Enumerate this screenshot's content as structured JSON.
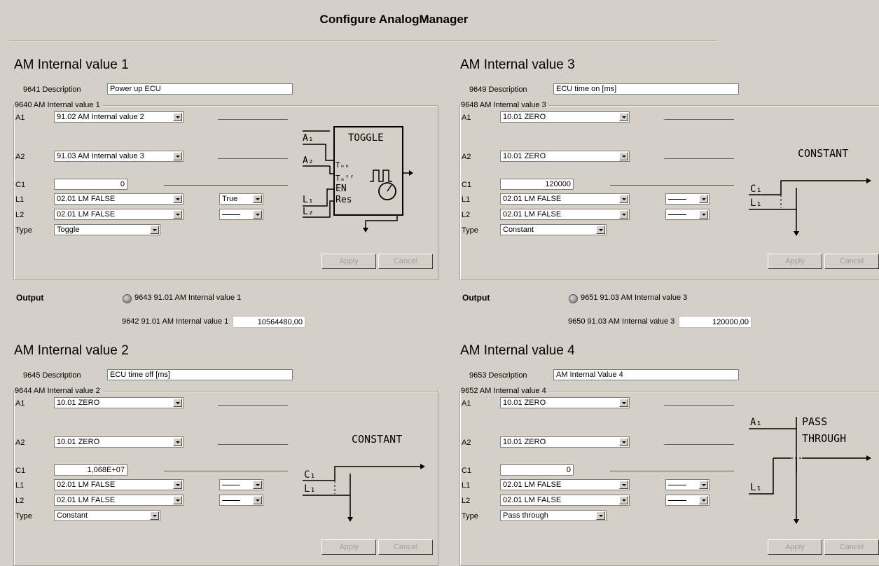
{
  "window_title": "Configure AnalogManager",
  "labels": {
    "a1": "A1",
    "a2": "A2",
    "c1": "C1",
    "l1": "L1",
    "l2": "L2",
    "type": "Type",
    "output": "Output",
    "apply": "Apply",
    "cancel": "Cancel"
  },
  "panels": [
    {
      "title": "AM Internal value 1",
      "description_label": "9641 Description",
      "description_value": "Power up ECU",
      "group_label": "9640 AM Internal value 1",
      "a1": "91.02 AM Internal value 2",
      "a2": "91.03 AM Internal value 3",
      "c1": "0",
      "l1": "02.01 LM FALSE",
      "l1_option": "True",
      "l2": "02.01 LM FALSE",
      "l2_option": "",
      "type": "Toggle",
      "diagram": {
        "kind": "toggle",
        "title": "TOGGLE",
        "a1": "A1",
        "a2": "A2",
        "ton": "TON",
        "toff": "TOFF",
        "en": "EN",
        "res": "Res",
        "l1": "L1",
        "l2": "L2"
      },
      "output_led_label": "9643 91.01 AM Internal value 1",
      "output_value_label": "9642 91.01 AM Internal value 1",
      "output_value": "10564480,00"
    },
    {
      "title": "AM Internal value 3",
      "description_label": "9649 Description",
      "description_value": "ECU time on [ms]",
      "group_label": "9648 AM Internal value 3",
      "a1": "10.01 ZERO",
      "a2": "10.01 ZERO",
      "c1": "120000",
      "l1": "02.01 LM FALSE",
      "l1_option": "",
      "l2": "02.01 LM FALSE",
      "l2_option": "",
      "type": "Constant",
      "diagram": {
        "kind": "constant",
        "title": "CONSTANT",
        "c1": "C1",
        "l1": "L1"
      },
      "output_led_label": "9651 91.03 AM Internal value 3",
      "output_value_label": "9650 91.03 AM Internal value 3",
      "output_value": "120000,00"
    },
    {
      "title": "AM Internal value 2",
      "description_label": "9645 Description",
      "description_value": "ECU time off [ms]",
      "group_label": "9644 AM Internal value 2",
      "a1": "10.01 ZERO",
      "a2": "10.01 ZERO",
      "c1": "1,068E+07",
      "l1": "02.01 LM FALSE",
      "l1_option": "",
      "l2": "02.01 LM FALSE",
      "l2_option": "",
      "type": "Constant",
      "diagram": {
        "kind": "constant",
        "title": "CONSTANT",
        "c1": "C1",
        "l1": "L1"
      }
    },
    {
      "title": "AM Internal value 4",
      "description_label": "9653 Description",
      "description_value": "AM Internal Value 4",
      "group_label": "9652 AM Internal value 4",
      "a1": "10.01 ZERO",
      "a2": "10.01 ZERO",
      "c1": "0",
      "l1": "02.01 LM FALSE",
      "l1_option": "",
      "l2": "02.01 LM FALSE",
      "l2_option": "",
      "type": "Pass through",
      "diagram": {
        "kind": "passthrough",
        "title1": "PASS",
        "title2": "THROUGH",
        "a1": "A1",
        "l1": "L1"
      }
    }
  ]
}
